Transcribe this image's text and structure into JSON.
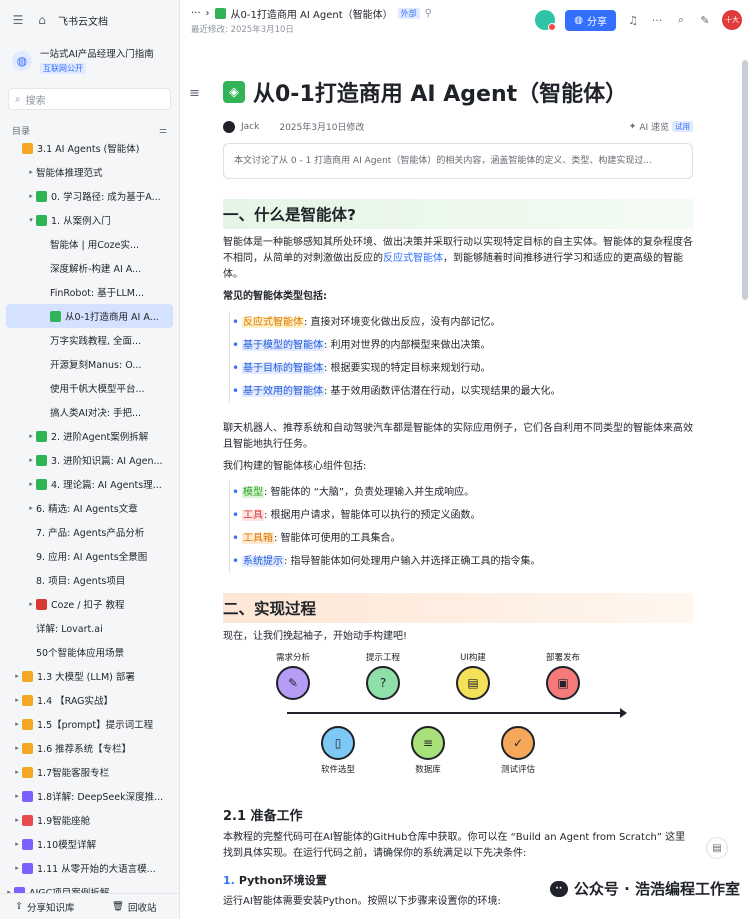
{
  "app": {
    "name": "飞书云文档"
  },
  "space": {
    "name": "一站式AI产品经理入门指南",
    "tag": "互联网公开"
  },
  "search": {
    "placeholder": "搜索"
  },
  "toc": {
    "title": "目录"
  },
  "tree": [
    {
      "label": "3.1 AI Agents (智能体)",
      "depth": 0,
      "arrow": "",
      "icon": "o"
    },
    {
      "label": "智能体推理范式",
      "depth": 1,
      "arrow": "▸",
      "icon": "doc"
    },
    {
      "label": "0. 学习路径: 成为基于A...",
      "depth": 1,
      "arrow": "▸",
      "icon": "g"
    },
    {
      "label": "1. 从案例入门",
      "depth": 1,
      "arrow": "▾",
      "icon": "g"
    },
    {
      "label": "智能体 | 用Coze实...",
      "depth": 2,
      "arrow": "",
      "icon": "doc"
    },
    {
      "label": "深度解析-构建 AI A...",
      "depth": 2,
      "arrow": "",
      "icon": "doc"
    },
    {
      "label": "FinRobot: 基于LLM...",
      "depth": 2,
      "arrow": "",
      "icon": "doc"
    },
    {
      "label": "从0-1打造商用 AI A...",
      "depth": 2,
      "arrow": "",
      "icon": "g",
      "selected": true
    },
    {
      "label": "万字实践教程, 全面...",
      "depth": 2,
      "arrow": "",
      "icon": "doc"
    },
    {
      "label": "开源复刻Manus: O...",
      "depth": 2,
      "arrow": "",
      "icon": "doc"
    },
    {
      "label": "使用千帆大模型平台...",
      "depth": 2,
      "arrow": "",
      "icon": "doc"
    },
    {
      "label": "搞人类AI对决: 手把...",
      "depth": 2,
      "arrow": "",
      "icon": "doc"
    },
    {
      "label": "2. 进阶Agent案例拆解",
      "depth": 1,
      "arrow": "▸",
      "icon": "g"
    },
    {
      "label": "3. 进阶知识篇: AI Agen...",
      "depth": 1,
      "arrow": "▸",
      "icon": "g"
    },
    {
      "label": "4. 理论篇: AI Agents理...",
      "depth": 1,
      "arrow": "▸",
      "icon": "g"
    },
    {
      "label": "6. 精选: AI Agents文章",
      "depth": 1,
      "arrow": "▸",
      "icon": "doc"
    },
    {
      "label": "7. 产品: Agents产品分析",
      "depth": 1,
      "arrow": "",
      "icon": "doc"
    },
    {
      "label": "9. 应用: AI Agents全景图",
      "depth": 1,
      "arrow": "",
      "icon": "doc"
    },
    {
      "label": "8. 项目: Agents项目",
      "depth": 1,
      "arrow": "",
      "icon": "doc"
    },
    {
      "label": "Coze / 扣子 教程",
      "depth": 1,
      "arrow": "▸",
      "icon": "red"
    },
    {
      "label": "详解: Lovart.ai",
      "depth": 1,
      "arrow": "",
      "icon": "doc"
    },
    {
      "label": "50个智能体应用场景",
      "depth": 1,
      "arrow": "",
      "icon": "doc"
    },
    {
      "label": "1.3 大模型 (LLM) 部署",
      "depth": 0,
      "arrow": "▸",
      "icon": "o"
    },
    {
      "label": "1.4 【RAG实战】",
      "depth": 0,
      "arrow": "▸",
      "icon": "o"
    },
    {
      "label": "1.5【prompt】提示词工程",
      "depth": 0,
      "arrow": "▸",
      "icon": "o"
    },
    {
      "label": "1.6 推荐系统【专栏】",
      "depth": 0,
      "arrow": "▸",
      "icon": "o"
    },
    {
      "label": "1.7智能客服专栏",
      "depth": 0,
      "arrow": "▸",
      "icon": "o"
    },
    {
      "label": "1.8详解: DeepSeek深度推...",
      "depth": 0,
      "arrow": "▸",
      "icon": "c"
    },
    {
      "label": "1.9智能座舱",
      "depth": 0,
      "arrow": "▸",
      "icon": "r"
    },
    {
      "label": "1.10模型详解",
      "depth": 0,
      "arrow": "▸",
      "icon": "c"
    },
    {
      "label": "1.11 从零开始的大语言模...",
      "depth": 0,
      "arrow": "▸",
      "icon": "c"
    },
    {
      "label": "AIGC项目案例拆解",
      "depth": 0,
      "arrow": "▸",
      "icon": "c",
      "outer": true
    }
  ],
  "footer": {
    "share": "分享知识库",
    "trash": "回收站"
  },
  "topbar": {
    "breadcrumb": "从0-1打造商用 AI Agent（智能体）",
    "external": "外部",
    "modified": "最近修改: 2025年3月10日",
    "share": "分享"
  },
  "doc": {
    "title": "从0-1打造商用 AI Agent（智能体）",
    "author": "Jack",
    "date": "2025年3月10日修改",
    "ai": "AI 速览",
    "try": "试用",
    "summary": "本文讨论了从 0 - 1 打造商用 AI Agent（智能体）的相关内容，涵盖智能体的定义、类型、构建实现过...",
    "h1": "一、什么是智能体?",
    "p1a": "智能体是一种能够感知其所处环境、做出决策并采取行动以实现特定目标的自主实体。智能体的复杂程度各不相同，从简单的对刺激做出反应的",
    "p1link": "反应式智能体",
    "p1b": "，到能够随着时间推移进行学习和适应的更高级的智能体。",
    "types_title": "常见的智能体类型包括:",
    "types": [
      {
        "term": "反应式智能体",
        "desc": ": 直接对环境变化做出反应，没有内部记忆。",
        "hl": "y"
      },
      {
        "term": "基于模型的智能体",
        "desc": ": 利用对世界的内部模型来做出决策。",
        "hl": "b"
      },
      {
        "term": "基于目标的智能体",
        "desc": ": 根据要实现的特定目标来规划行动。",
        "hl": "b"
      },
      {
        "term": "基于效用的智能体",
        "desc": ": 基于效用函数评估潜在行动，以实现结果的最大化。",
        "hl": "b"
      }
    ],
    "p2": "聊天机器人、推荐系统和自动驾驶汽车都是智能体的实际应用例子，它们各自利用不同类型的智能体来高效且智能地执行任务。",
    "comp_title": "我们构建的智能体核心组件包括:",
    "components": [
      {
        "term": "模型",
        "desc": ": 智能体的 “大脑”，负责处理输入并生成响应。",
        "hl": "g"
      },
      {
        "term": "工具",
        "desc": ": 根据用户请求，智能体可以执行的预定义函数。",
        "hl": "p"
      },
      {
        "term": "工具箱",
        "desc": ": 智能体可使用的工具集合。",
        "hl": "o"
      },
      {
        "term": "系统提示",
        "desc": ": 指导智能体如何处理用户输入并选择正确工具的指令集。",
        "hl": "bl"
      }
    ],
    "h2": "二、实现过程",
    "p3": "现在，让我们挽起袖子，开始动手构建吧!",
    "diagram": [
      {
        "label": "需求分析",
        "pos": "top",
        "color": "#b69cf5",
        "icon": "✎"
      },
      {
        "label": "软件选型",
        "pos": "bottom",
        "color": "#7ec8f5",
        "icon": "▯"
      },
      {
        "label": "提示工程",
        "pos": "top",
        "color": "#8fe0a8",
        "icon": "?"
      },
      {
        "label": "数据库",
        "pos": "bottom",
        "color": "#a8e07a",
        "icon": "≡"
      },
      {
        "label": "UI构建",
        "pos": "top",
        "color": "#f5e05a",
        "icon": "▤"
      },
      {
        "label": "测试评估",
        "pos": "bottom",
        "color": "#f5a85a",
        "icon": "✓"
      },
      {
        "label": "部署发布",
        "pos": "top",
        "color": "#f57a7a",
        "icon": "▣"
      }
    ],
    "h3": "2.1 准备工作",
    "p4": "本教程的完整代码可在AI智能体的GitHub仓库中获取。你可以在 “Build an Agent from Scratch” 这里找到具体实现。在运行代码之前，请确保你的系统满足以下先决条件:",
    "h4num": "1.",
    "h4": "Python环境设置",
    "p5": "运行AI智能体需要安装Python。按照以下步骤来设置你的环境:"
  },
  "watermark": "公众号 · 浩浩编程工作室"
}
